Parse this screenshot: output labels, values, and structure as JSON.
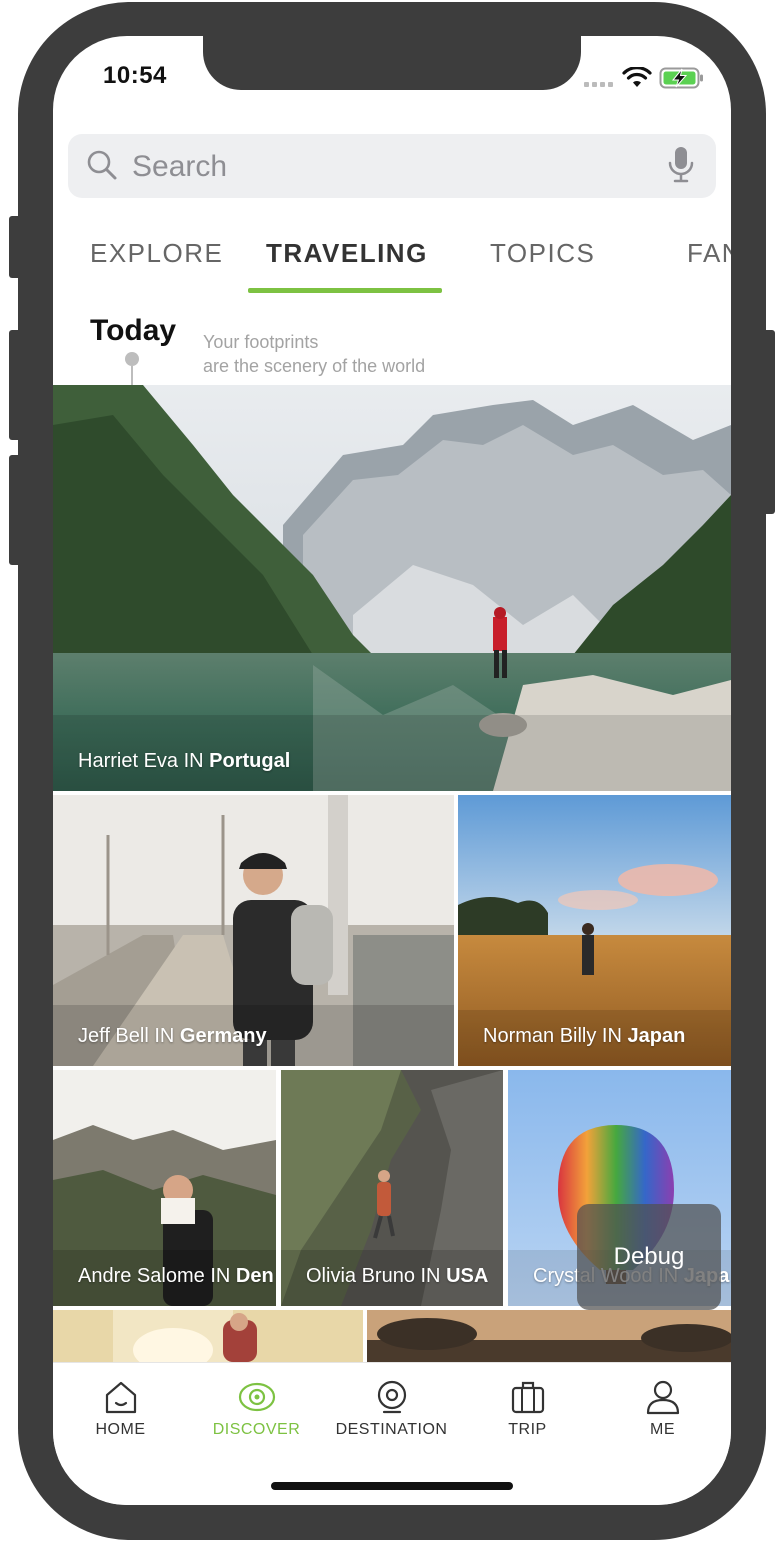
{
  "status_bar": {
    "time": "10:54"
  },
  "search": {
    "placeholder": "Search"
  },
  "tabs": [
    {
      "label": "EXPLORE"
    },
    {
      "label": "TRAVELING",
      "active": true
    },
    {
      "label": "TOPICS"
    },
    {
      "label": "FAN"
    }
  ],
  "header": {
    "title": "Today",
    "tagline_line1": "Your footprints",
    "tagline_line2": "are the scenery of the world"
  },
  "photos": [
    {
      "name": "Harriet Eva",
      "connector": "IN",
      "place": "Portugal"
    },
    {
      "name": "Jeff Bell",
      "connector": "IN",
      "place": "Germany"
    },
    {
      "name": "Norman Billy",
      "connector": "IN",
      "place": "Japan"
    },
    {
      "name": "Andre Salome",
      "connector": "IN",
      "place": "Den"
    },
    {
      "name": "Olivia Bruno",
      "connector": "IN",
      "place": "USA"
    },
    {
      "name": "Crystal Wood",
      "connector": "IN",
      "place": "Japa"
    }
  ],
  "debug_button": {
    "label": "Debug"
  },
  "tab_bar": [
    {
      "label": "HOME"
    },
    {
      "label": "DISCOVER",
      "active": true
    },
    {
      "label": "DESTINATION"
    },
    {
      "label": "TRIP"
    },
    {
      "label": "ME"
    }
  ],
  "colors": {
    "accent": "#7dc242",
    "frame": "#3d3d3d"
  }
}
